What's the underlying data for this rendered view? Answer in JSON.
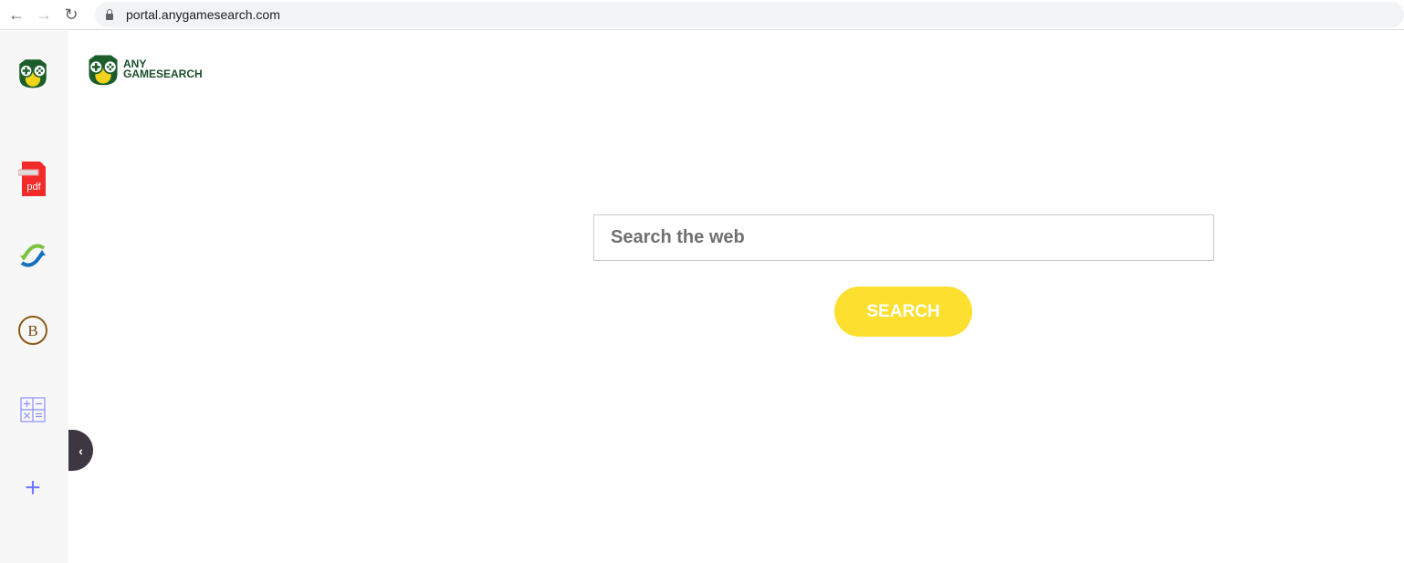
{
  "browser": {
    "url": "portal.anygamesearch.com"
  },
  "logo": {
    "line1": "ANY",
    "line2": "GAMESEARCH"
  },
  "sidebar": {
    "items": [
      {
        "icon": "pdf-icon",
        "label": "pdf"
      },
      {
        "icon": "convert-arrows-icon"
      },
      {
        "icon": "bitcoin-icon",
        "label": "B"
      },
      {
        "icon": "calculator-icon"
      },
      {
        "icon": "plus-icon"
      }
    ]
  },
  "search": {
    "placeholder": "Search the web",
    "button": "SEARCH"
  },
  "colors": {
    "button": "#fddf2f",
    "brand": "#1b4d2b",
    "toggle": "#3d3743"
  }
}
